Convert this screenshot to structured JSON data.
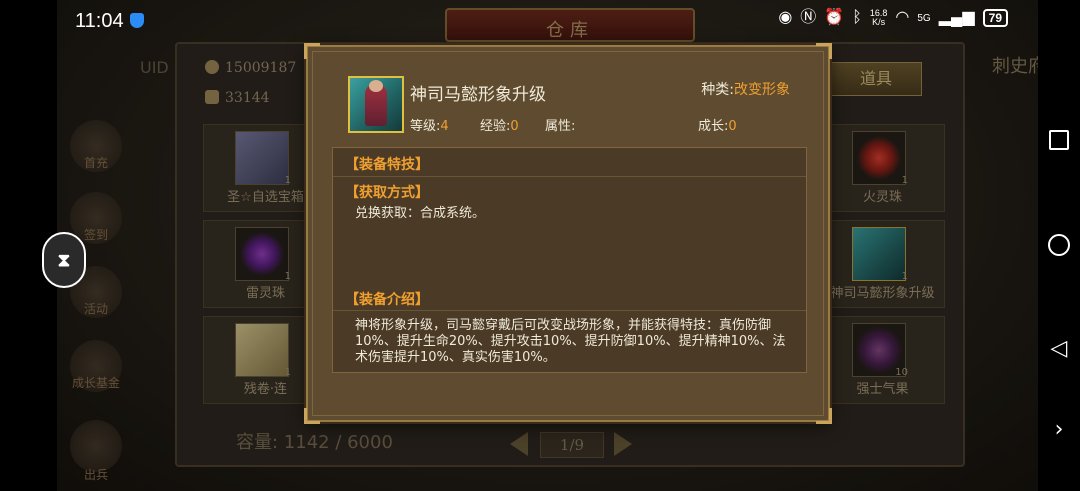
{
  "status_bar": {
    "time": "11:04",
    "net_speed_value": "16.8",
    "net_speed_unit": "K/s",
    "signal_label": "5G",
    "battery": "79"
  },
  "warehouse": {
    "title": "仓库",
    "gold": "15009187",
    "ingots": "33144",
    "tab_active": "道具",
    "right_label": "刺史府",
    "uid_label": "UID",
    "capacity": "容量: 1142 / 6000",
    "page": "1/9",
    "side_menu": [
      "首充",
      "签到",
      "活动",
      "成长基金",
      "出兵"
    ],
    "items_left": [
      {
        "label": "圣☆自选宝箱",
        "count": "1"
      },
      {
        "label": "雷灵珠",
        "count": "1"
      },
      {
        "label": "残卷·连",
        "count": "1"
      }
    ],
    "items_right": [
      {
        "label": "火灵珠",
        "count": "1"
      },
      {
        "label": "神司马懿形象升级",
        "count": "1"
      },
      {
        "label": "强士气果",
        "count": "10"
      }
    ]
  },
  "modal": {
    "item_name": "神司马懿形象升级",
    "type_label": "种类:",
    "type_value": "改变形象",
    "level_label": "等级:",
    "level_value": "4",
    "exp_label": "经验:",
    "exp_value": "0",
    "attr_label": "属性:",
    "growth_label": "成长:",
    "growth_value": "0",
    "skill_title": "【装备特技】",
    "source_title": "【获取方式】",
    "source_text": "兑换获取：合成系统。",
    "intro_title": "【装备介绍】",
    "intro_text": "神将形象升级，司马懿穿戴后可改变战场形象，并能获得特技：真伤防御10%、提升生命20%、提升攻击10%、提升防御10%、提升精神10%、法术伤害提升10%、真实伤害10%。"
  },
  "colors": {
    "accent_orange": "#f0a030",
    "modal_bg": "#5e4b30",
    "gold_border": "#c9a45a"
  }
}
